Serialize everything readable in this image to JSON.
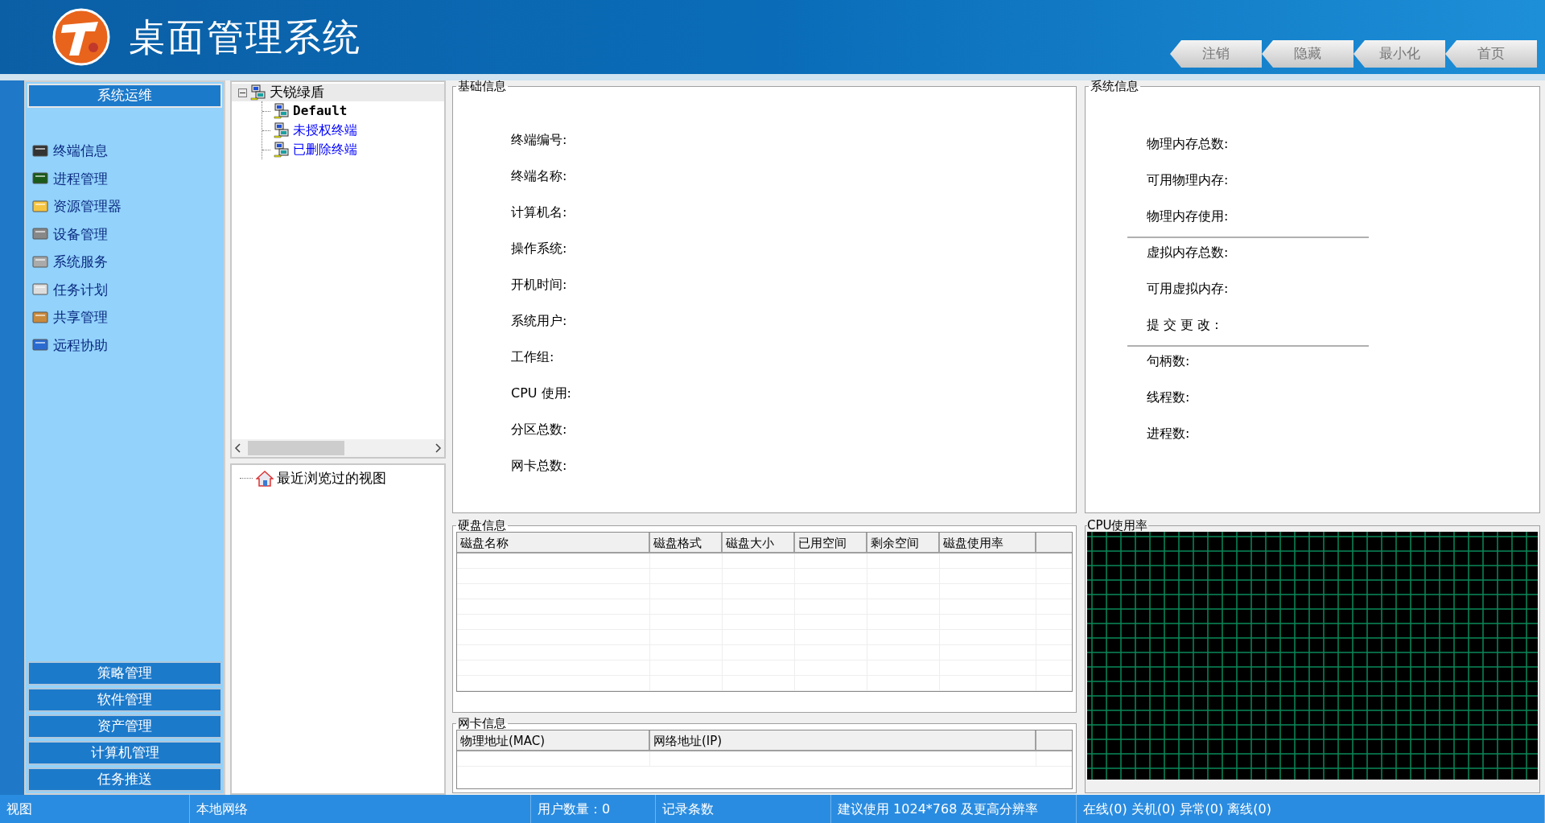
{
  "header": {
    "title": "桌面管理系统",
    "buttons": [
      "注销",
      "隐藏",
      "最小化",
      "首页"
    ]
  },
  "sidebar": {
    "sections": [
      {
        "label": "系统运维",
        "selected": true,
        "items": [
          "终端信息",
          "进程管理",
          "资源管理器",
          "设备管理",
          "系统服务",
          "任务计划",
          "共享管理",
          "远程协助"
        ]
      },
      {
        "label": "策略管理",
        "selected": false
      },
      {
        "label": "软件管理",
        "selected": false
      },
      {
        "label": "资产管理",
        "selected": false
      },
      {
        "label": "计算机管理",
        "selected": false
      },
      {
        "label": "任务推送",
        "selected": false
      }
    ]
  },
  "tree": {
    "root": {
      "label": "天锐绿盾",
      "expanded": true,
      "selected": true,
      "children": [
        {
          "label": "Default",
          "color": "#000000"
        },
        {
          "label": "未授权终端",
          "color": "#0000ff"
        },
        {
          "label": "已删除终端",
          "color": "#0000ff"
        }
      ]
    }
  },
  "recent_views": {
    "label": "最近浏览过的视图"
  },
  "basic_info": {
    "title": "基础信息",
    "fields": [
      "终端编号:",
      "终端名称:",
      "计算机名:",
      "操作系统:",
      "开机时间:",
      "系统用户:",
      "工作组:",
      "CPU 使用:",
      "分区总数:",
      "网卡总数:"
    ]
  },
  "system_info": {
    "title": "系统信息",
    "groups": [
      [
        "物理内存总数:",
        "可用物理内存:",
        "物理内存使用:"
      ],
      [
        "虚拟内存总数:",
        "可用虚拟内存:",
        "提 交 更 改 :"
      ],
      [
        "句柄数:",
        "线程数:",
        "进程数:"
      ]
    ]
  },
  "disk_info": {
    "title": "硬盘信息",
    "columns": [
      "磁盘名称",
      "磁盘格式",
      "磁盘大小",
      "已用空间",
      "剩余空间",
      "磁盘使用率"
    ]
  },
  "nic_info": {
    "title": "网卡信息",
    "columns": [
      "物理地址(MAC)",
      "网络地址(IP)"
    ]
  },
  "cpu_usage": {
    "title": "CPU使用率"
  },
  "status_bar": [
    "视图",
    "本地网络",
    "用户数量：0",
    "记录条数",
    "建议使用 1024*768 及更高分辨率",
    "在线(0) 关机(0) 异常(0) 离线(0)"
  ]
}
